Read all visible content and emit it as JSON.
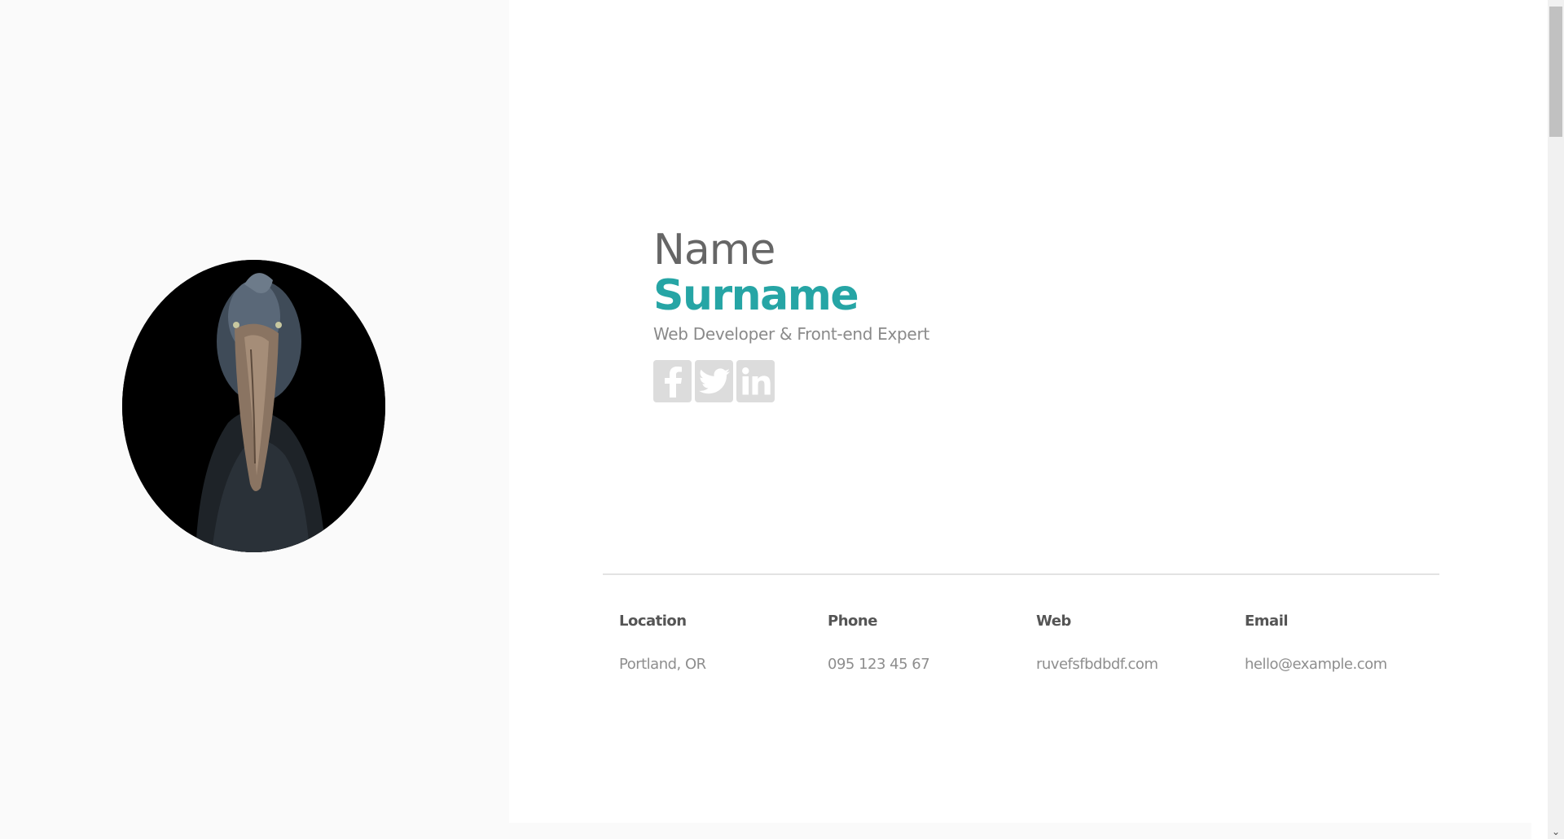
{
  "profile": {
    "first_name": "Name",
    "surname": "Surname",
    "tagline": "Web Developer & Front-end Expert",
    "avatar_alt": "shoebill-bird-photo"
  },
  "social": [
    {
      "name": "facebook",
      "icon": "facebook-icon"
    },
    {
      "name": "twitter",
      "icon": "twitter-icon"
    },
    {
      "name": "linkedin",
      "icon": "linkedin-icon"
    }
  ],
  "contacts": [
    {
      "label": "Location",
      "value": "Portland, OR"
    },
    {
      "label": "Phone",
      "value": "095 123 45 67"
    },
    {
      "label": "Web",
      "value": "ruvefsfbdbdf.com"
    },
    {
      "label": "Email",
      "value": "hello@example.com"
    }
  ],
  "colors": {
    "accent": "#26a5a5",
    "heading": "#666666",
    "muted": "#8a8a8a",
    "social_bg": "#dcdcdc",
    "left_panel_bg": "#fafafa"
  }
}
